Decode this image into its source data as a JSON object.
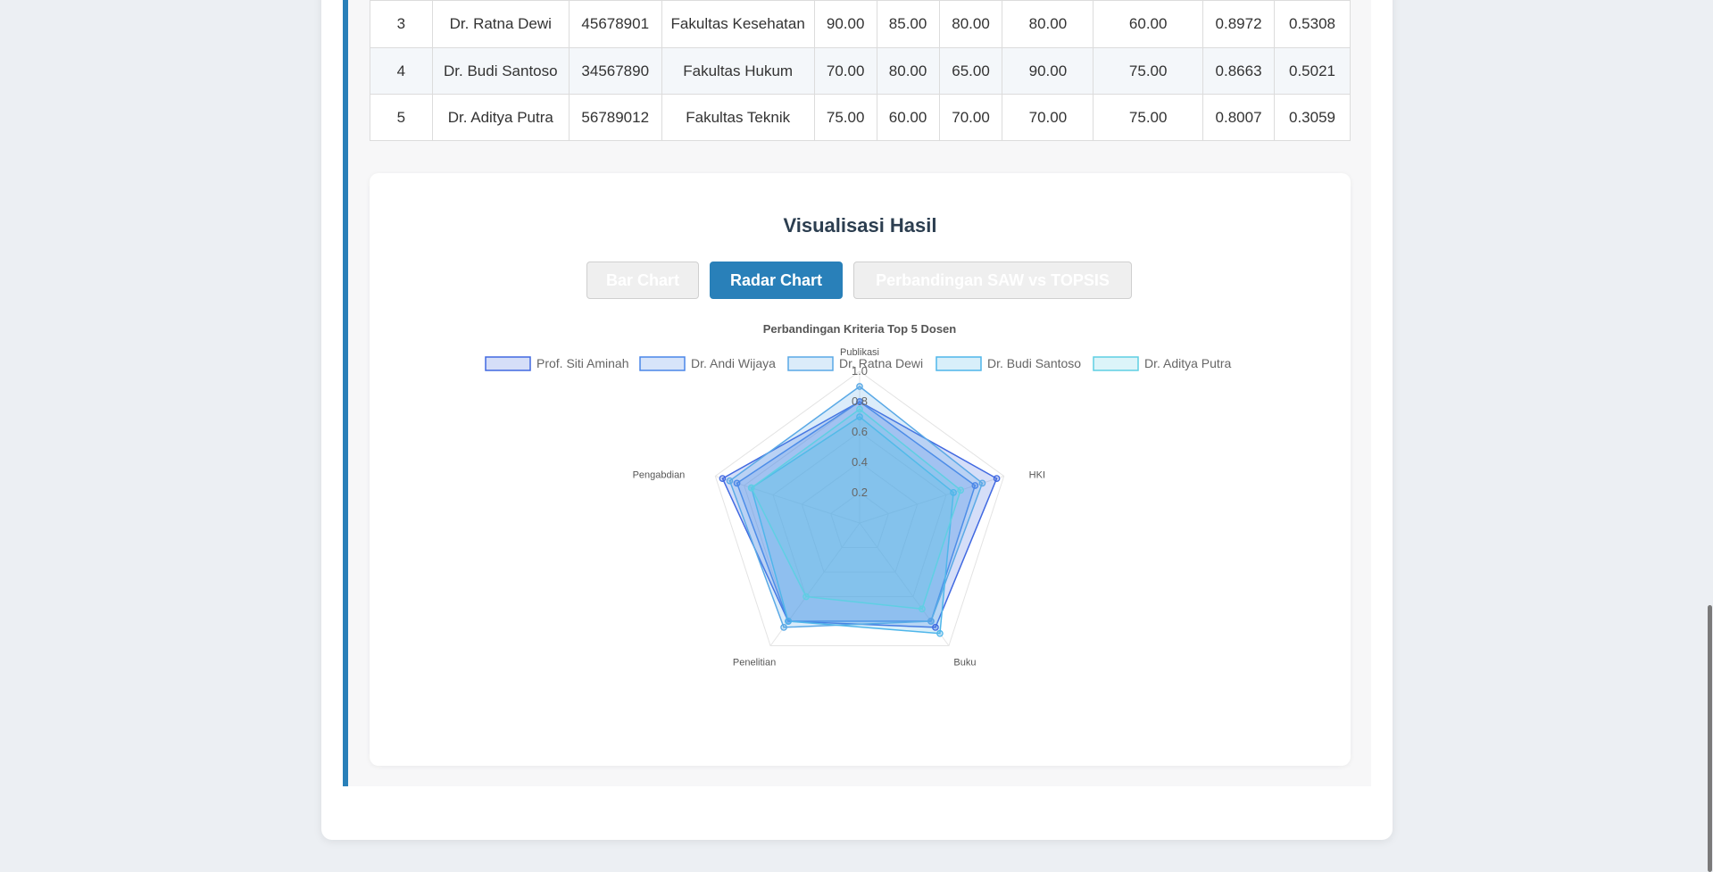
{
  "table": {
    "rows": [
      {
        "rank": "3",
        "name": "Dr. Ratna Dewi",
        "nidn": "45678901",
        "faculty": "Fakultas Kesehatan",
        "c1": "90.00",
        "c2": "85.00",
        "c3": "80.00",
        "c4": "80.00",
        "c5": "60.00",
        "saw": "0.8972",
        "topsis": "0.5308"
      },
      {
        "rank": "4",
        "name": "Dr. Budi Santoso",
        "nidn": "34567890",
        "faculty": "Fakultas Hukum",
        "c1": "70.00",
        "c2": "80.00",
        "c3": "65.00",
        "c4": "90.00",
        "c5": "75.00",
        "saw": "0.8663",
        "topsis": "0.5021"
      },
      {
        "rank": "5",
        "name": "Dr. Aditya Putra",
        "nidn": "56789012",
        "faculty": "Fakultas Teknik",
        "c1": "75.00",
        "c2": "60.00",
        "c3": "70.00",
        "c4": "70.00",
        "c5": "75.00",
        "saw": "0.8007",
        "topsis": "0.3059"
      }
    ]
  },
  "visualization": {
    "title": "Visualisasi Hasil",
    "buttons": {
      "bar": "Bar Chart",
      "radar": "Radar Chart",
      "compare": "Perbandingan SAW vs TOPSIS"
    },
    "active_tab": "radar"
  },
  "chart_data": {
    "type": "radar",
    "title": "Perbandingan Kriteria Top 5 Dosen",
    "axes": [
      "Publikasi",
      "HKI",
      "Buku",
      "Penelitian",
      "Pengabdian"
    ],
    "r_range": [
      0,
      1.0
    ],
    "ticks": [
      "0.2",
      "0.4",
      "0.6",
      "0.8",
      "1.0"
    ],
    "legend_position": "top",
    "series": [
      {
        "name": "Prof. Siti Aminah",
        "color": "#4169e1",
        "values": [
          0.8,
          0.95,
          0.85,
          0.8,
          0.95
        ]
      },
      {
        "name": "Dr. Andi Wijaya",
        "color": "#4a86e8",
        "values": [
          0.8,
          0.8,
          0.8,
          0.8,
          0.85
        ]
      },
      {
        "name": "Dr. Ratna Dewi",
        "color": "#5aa9e6",
        "values": [
          0.9,
          0.85,
          0.8,
          0.85,
          0.9
        ]
      },
      {
        "name": "Dr. Budi Santoso",
        "color": "#4fb6ea",
        "values": [
          0.7,
          0.65,
          0.9,
          0.8,
          0.75
        ]
      },
      {
        "name": "Dr. Aditya Putra",
        "color": "#5fcfe3",
        "values": [
          0.75,
          0.7,
          0.7,
          0.6,
          0.75
        ]
      }
    ]
  }
}
